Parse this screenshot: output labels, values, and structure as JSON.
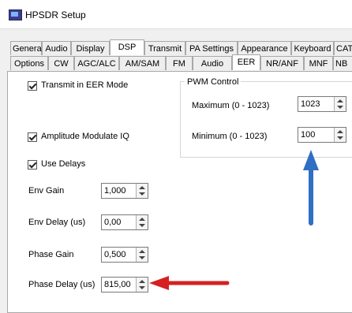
{
  "window": {
    "title": "HPSDR Setup"
  },
  "tabs_row1": [
    {
      "label": "General"
    },
    {
      "label": "Audio"
    },
    {
      "label": "Display"
    },
    {
      "label": "DSP",
      "active": true
    },
    {
      "label": "Transmit"
    },
    {
      "label": "PA Settings"
    },
    {
      "label": "Appearance"
    },
    {
      "label": "Keyboard"
    },
    {
      "label": "CAT"
    }
  ],
  "tabs_row2": [
    {
      "label": "Options"
    },
    {
      "label": "CW"
    },
    {
      "label": "AGC/ALC"
    },
    {
      "label": "AM/SAM"
    },
    {
      "label": "FM"
    },
    {
      "label": "Audio"
    },
    {
      "label": "EER",
      "active": true
    },
    {
      "label": "NR/ANF"
    },
    {
      "label": "MNF"
    },
    {
      "label": "NB"
    }
  ],
  "eer": {
    "transmit_in_eer_label": "Transmit in EER Mode",
    "transmit_in_eer_checked": true,
    "amplitude_modulate_label": "Amplitude Modulate IQ",
    "amplitude_modulate_checked": true,
    "use_delays_label": "Use Delays",
    "use_delays_checked": true,
    "env_gain": {
      "label": "Env Gain",
      "value": "1,000"
    },
    "env_delay": {
      "label": "Env Delay (us)",
      "value": "0,00"
    },
    "phase_gain": {
      "label": "Phase Gain",
      "value": "0,500"
    },
    "phase_delay": {
      "label": "Phase Delay (us)",
      "value": "815,00"
    }
  },
  "pwm": {
    "title": "PWM Control",
    "maximum": {
      "label": "Maximum (0 - 1023)",
      "value": "1023"
    },
    "minimum": {
      "label": "Minimum (0 - 1023)",
      "value": "100"
    }
  },
  "annotations": {
    "blue_arrow_color": "#2f6fc4",
    "red_arrow_color": "#d62020"
  }
}
